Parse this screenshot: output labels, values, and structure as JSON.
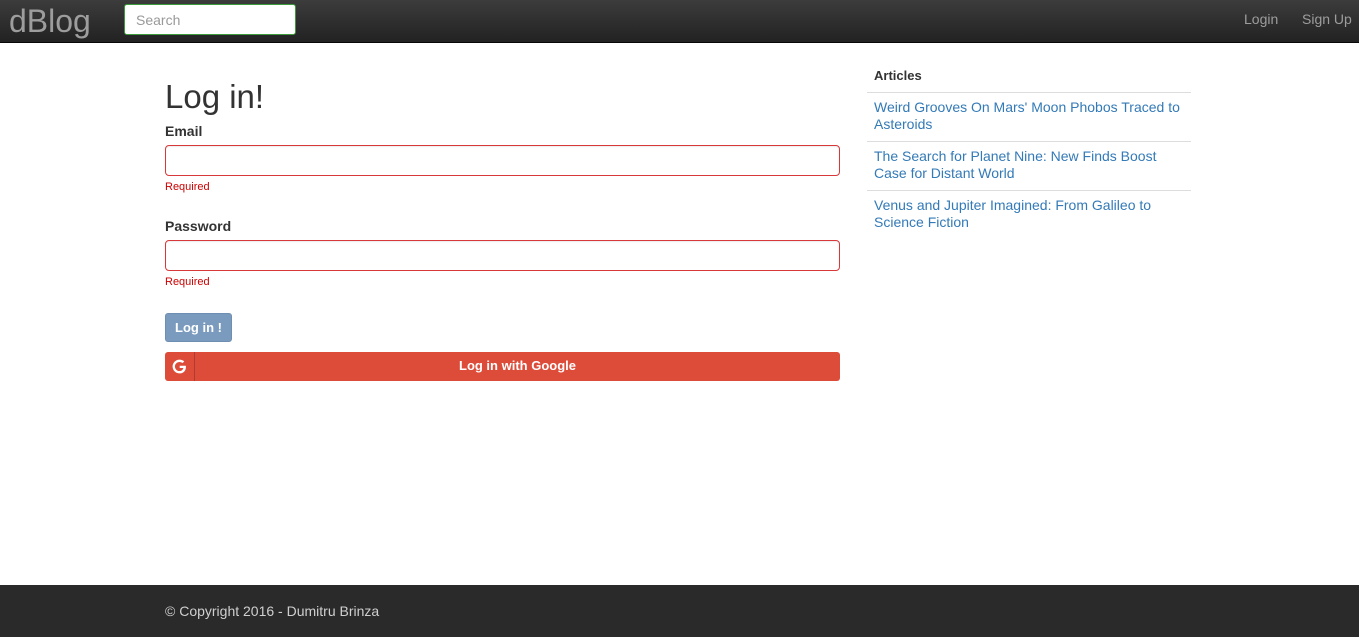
{
  "navbar": {
    "brand": "dBlog",
    "search_placeholder": "Search",
    "login_label": "Login",
    "signup_label": "Sign Up"
  },
  "main": {
    "title": "Log in!",
    "email_label": "Email",
    "email_error": "Required",
    "password_label": "Password",
    "password_error": "Required",
    "login_button": "Log in !",
    "google_button": "Log in with Google"
  },
  "sidebar": {
    "title": "Articles",
    "articles": [
      "Weird Grooves On Mars' Moon Phobos Traced to Asteroids",
      "The Search for Planet Nine: New Finds Boost Case for Distant World",
      "Venus and Jupiter Imagined: From Galileo to Science Fiction"
    ]
  },
  "footer": {
    "copyright": "© Copyright 2016 - Dumitru Brinza"
  },
  "colors": {
    "navbar_bg": "#222222",
    "error": "#cc0000",
    "login_button": "#7a9bbd",
    "google_button": "#dd4b39",
    "link": "#337ab7",
    "footer_bg": "#2a2a2a"
  },
  "icons": {
    "google": "google-icon"
  }
}
